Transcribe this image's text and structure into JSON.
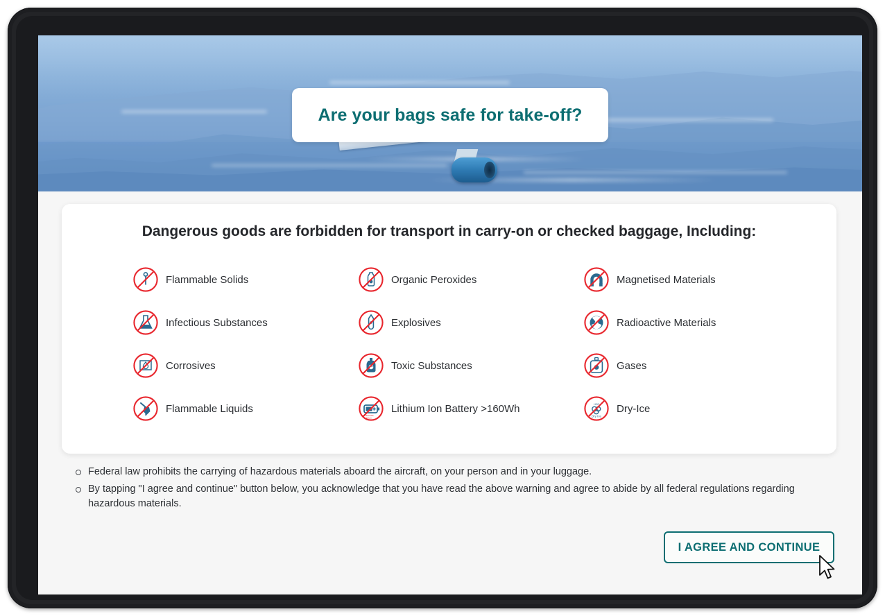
{
  "hero": {
    "title": "Are your bags safe for take-off?",
    "accent_color": "#0d6e72",
    "image_description": "airplane-over-mountains"
  },
  "card": {
    "heading": "Dangerous goods are forbidden for transport in carry-on or checked baggage, Including:",
    "items": [
      {
        "label": "Flammable Solids",
        "icon": "flammable-solids-icon"
      },
      {
        "label": "Organic Peroxides",
        "icon": "organic-peroxides-icon"
      },
      {
        "label": "Magnetised Materials",
        "icon": "magnetised-materials-icon"
      },
      {
        "label": "Infectious Substances",
        "icon": "infectious-substances-icon"
      },
      {
        "label": "Explosives",
        "icon": "explosives-icon"
      },
      {
        "label": "Radioactive Materials",
        "icon": "radioactive-materials-icon"
      },
      {
        "label": "Corrosives",
        "icon": "corrosives-icon"
      },
      {
        "label": "Toxic Substances",
        "icon": "toxic-substances-icon"
      },
      {
        "label": "Gases",
        "icon": "gases-icon"
      },
      {
        "label": "Flammable Liquids",
        "icon": "flammable-liquids-icon"
      },
      {
        "label": "Lithium Ion Battery >160Wh",
        "icon": "lithium-battery-icon"
      },
      {
        "label": "Dry-Ice",
        "icon": "dry-ice-icon"
      }
    ],
    "icon_colors": {
      "prohibition": "#e8262d",
      "symbol": "#2a6a90"
    }
  },
  "notes": {
    "bullets": [
      "Federal law prohibits the carrying of hazardous materials aboard the aircraft, on your person and in your luggage.",
      "By tapping \"I agree and continue\" button below, you acknowledge that you have read the above warning and agree to abide by all federal regulations regarding hazardous materials."
    ]
  },
  "actions": {
    "agree_label": "I AGREE AND CONTINUE"
  }
}
